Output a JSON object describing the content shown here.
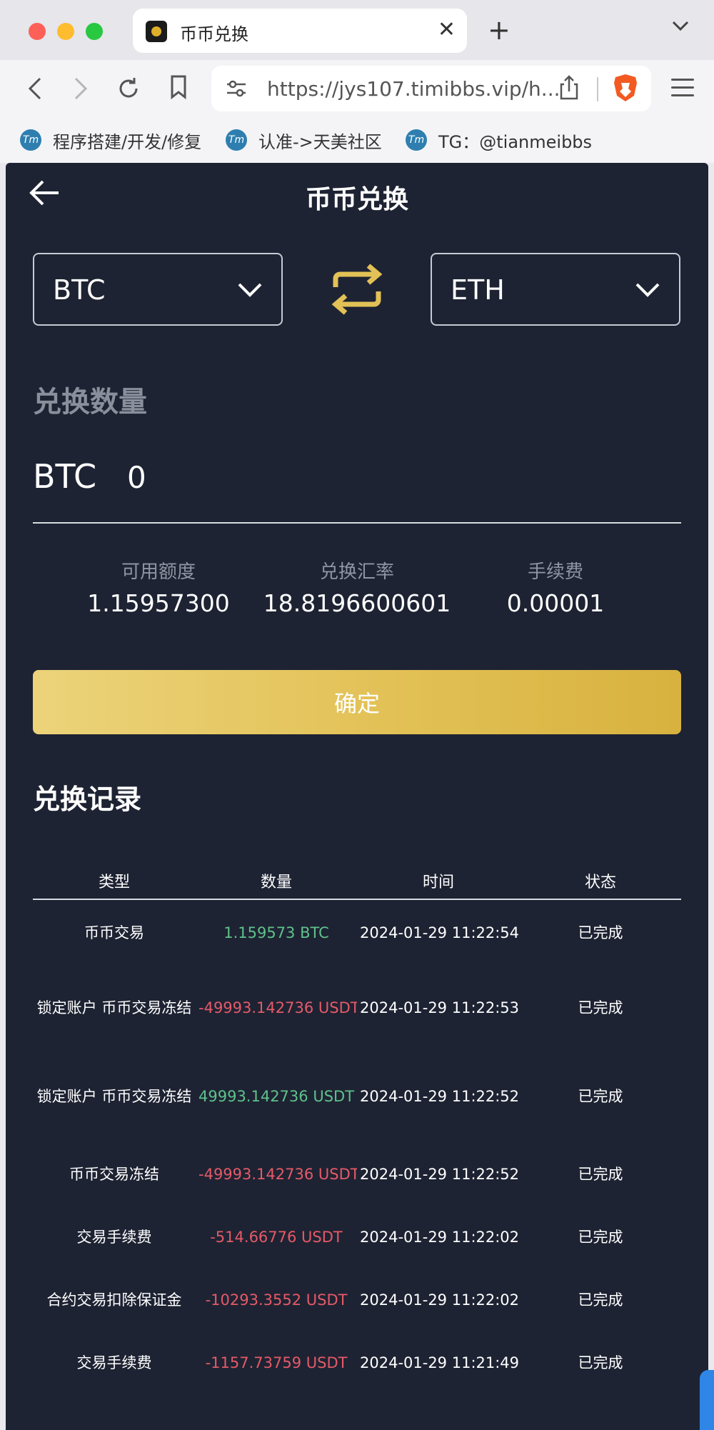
{
  "browser": {
    "tab_title": "币币兑换",
    "url": "https://jys107.timibbs.vip/h...",
    "bookmarks": [
      {
        "label": "程序搭建/开发/修复"
      },
      {
        "label": "认准->天美社区"
      },
      {
        "label": "TG：@tianmeibbs"
      }
    ]
  },
  "page": {
    "title": "币币兑换",
    "from_currency": "BTC",
    "to_currency": "ETH",
    "amount_label": "兑换数量",
    "amount_currency": "BTC",
    "amount_value": "0",
    "stats": [
      {
        "label": "可用额度",
        "value": "1.15957300"
      },
      {
        "label": "兑换汇率",
        "value": "18.8196600601"
      },
      {
        "label": "手续费",
        "value": "0.00001"
      }
    ],
    "confirm_label": "确定",
    "records_title": "兑换记录"
  },
  "records": {
    "headers": [
      "类型",
      "数量",
      "时间",
      "状态"
    ],
    "rows": [
      {
        "type": "币币交易",
        "amount": "1.159573 BTC",
        "time": "2024-01-29 11:22:54",
        "status": "已完成"
      },
      {
        "type": "锁定账户 币币交易冻结",
        "amount": "-49993.142736 USDT",
        "time": "2024-01-29 11:22:53",
        "status": "已完成"
      },
      {
        "type": "锁定账户 币币交易冻结",
        "amount": "49993.142736 USDT",
        "time": "2024-01-29 11:22:52",
        "status": "已完成"
      },
      {
        "type": "币币交易冻结",
        "amount": "-49993.142736 USDT",
        "time": "2024-01-29 11:22:52",
        "status": "已完成"
      },
      {
        "type": "交易手续费",
        "amount": "-514.66776 USDT",
        "time": "2024-01-29 11:22:02",
        "status": "已完成"
      },
      {
        "type": "合约交易扣除保证金",
        "amount": "-10293.3552 USDT",
        "time": "2024-01-29 11:22:02",
        "status": "已完成"
      },
      {
        "type": "交易手续费",
        "amount": "-1157.73759 USDT",
        "time": "2024-01-29 11:21:49",
        "status": "已完成"
      }
    ]
  },
  "colors": {
    "app_bg": "#1e2333",
    "accent_gold": "#e2c156",
    "positive": "#5ec28a",
    "negative": "#e55a68"
  }
}
